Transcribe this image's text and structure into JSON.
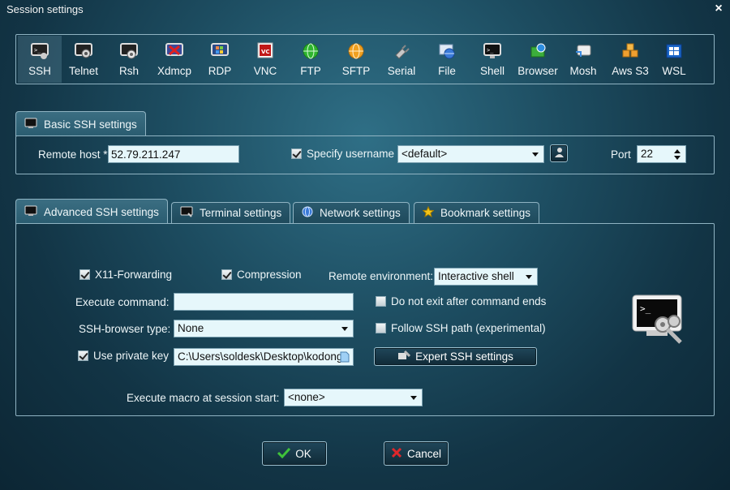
{
  "window": {
    "title": "Session settings",
    "close_glyph": "×"
  },
  "session_types": [
    {
      "label": "SSH",
      "icon": "ssh-terminal-icon",
      "selected": true
    },
    {
      "label": "Telnet",
      "icon": "telnet-icon"
    },
    {
      "label": "Rsh",
      "icon": "rsh-icon"
    },
    {
      "label": "Xdmcp",
      "icon": "xdmcp-icon"
    },
    {
      "label": "RDP",
      "icon": "rdp-icon"
    },
    {
      "label": "VNC",
      "icon": "vnc-icon"
    },
    {
      "label": "FTP",
      "icon": "ftp-globe-icon"
    },
    {
      "label": "SFTP",
      "icon": "sftp-globe-icon"
    },
    {
      "label": "Serial",
      "icon": "serial-plug-icon"
    },
    {
      "label": "File",
      "icon": "file-icon"
    },
    {
      "label": "Shell",
      "icon": "shell-terminal-icon"
    },
    {
      "label": "Browser",
      "icon": "browser-icon"
    },
    {
      "label": "Mosh",
      "icon": "mosh-icon"
    },
    {
      "label": "Aws S3",
      "icon": "aws-s3-cubes-icon"
    },
    {
      "label": "WSL",
      "icon": "wsl-windows-icon"
    }
  ],
  "basic": {
    "tab_label": "Basic SSH settings",
    "remote_host_label": "Remote host *",
    "remote_host_value": "52.79.211.247",
    "specify_username_label": "Specify username",
    "specify_username_checked": true,
    "username_value": "<default>",
    "port_label": "Port",
    "port_value": "22"
  },
  "tabs": [
    {
      "label": "Advanced SSH settings",
      "icon": "terminal-icon",
      "active": true
    },
    {
      "label": "Terminal settings",
      "icon": "terminal-icon"
    },
    {
      "label": "Network settings",
      "icon": "network-globe-icon"
    },
    {
      "label": "Bookmark settings",
      "icon": "star-icon"
    }
  ],
  "advanced": {
    "x11_label": "X11-Forwarding",
    "x11_checked": true,
    "compression_label": "Compression",
    "compression_checked": true,
    "remote_env_label": "Remote environment:",
    "remote_env_value": "Interactive shell",
    "exec_cmd_label": "Execute command:",
    "exec_cmd_value": "",
    "no_exit_label": "Do not exit after command ends",
    "no_exit_checked": false,
    "browser_type_label": "SSH-browser type:",
    "browser_type_value": "None",
    "follow_path_label": "Follow SSH path (experimental)",
    "follow_path_checked": false,
    "private_key_label": "Use private key",
    "private_key_checked": true,
    "private_key_value": "C:\\Users\\soldesk\\Desktop\\kodong",
    "expert_button_label": "Expert SSH settings",
    "macro_label": "Execute macro at session start:",
    "macro_value": "<none>"
  },
  "buttons": {
    "ok_label": "OK",
    "cancel_label": "Cancel"
  },
  "colors": {
    "ok_check": "#3fc23a",
    "cancel_x": "#e0272b",
    "accent_frame": "#8fb3c2"
  }
}
